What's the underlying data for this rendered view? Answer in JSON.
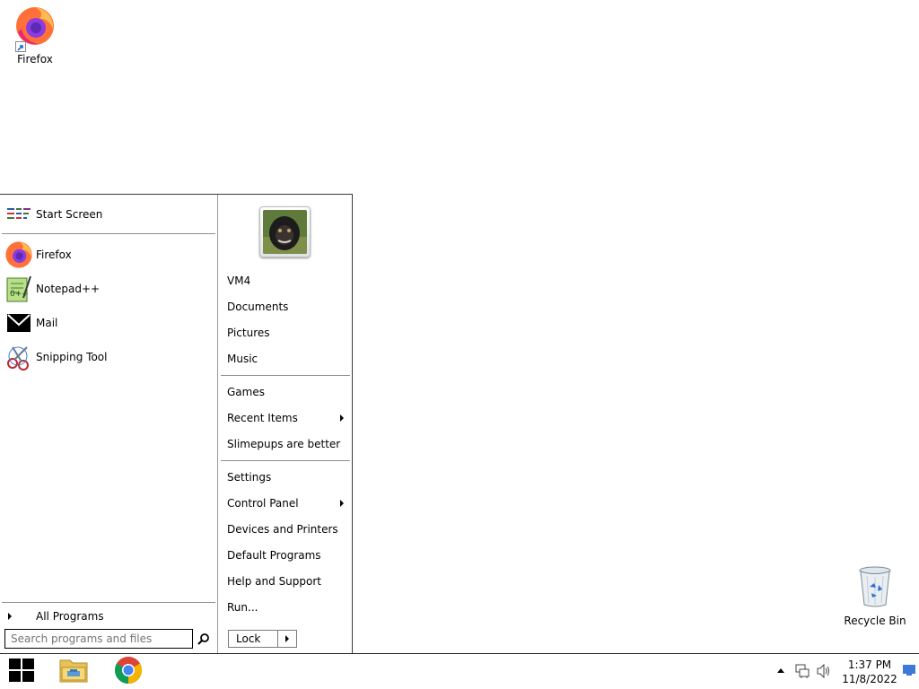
{
  "desktop": {
    "icons": [
      {
        "label": "Firefox",
        "icon": "firefox-icon"
      },
      {
        "label": "Recycle Bin",
        "icon": "recycle-bin-icon"
      }
    ]
  },
  "start_menu": {
    "start_screen_label": "Start Screen",
    "pinned": [
      {
        "label": "Firefox",
        "icon": "firefox-icon"
      },
      {
        "label": "Notepad++",
        "icon": "notepad-plus-plus-icon"
      },
      {
        "label": "Mail",
        "icon": "mail-icon"
      },
      {
        "label": "Snipping Tool",
        "icon": "scissors-icon"
      }
    ],
    "all_programs_label": "All Programs",
    "search": {
      "placeholder": "Search programs and files",
      "value": ""
    },
    "right": {
      "group1": [
        "VM4",
        "Documents",
        "Pictures",
        "Music"
      ],
      "group2": [
        {
          "label": "Games",
          "submenu": false
        },
        {
          "label": "Recent Items",
          "submenu": true
        },
        {
          "label": "Slimepups are better",
          "submenu": false
        }
      ],
      "group3": [
        {
          "label": "Settings",
          "submenu": false
        },
        {
          "label": "Control Panel",
          "submenu": true
        },
        {
          "label": "Devices and Printers",
          "submenu": false
        },
        {
          "label": "Default Programs",
          "submenu": false
        },
        {
          "label": "Help and Support",
          "submenu": false
        },
        {
          "label": "Run...",
          "submenu": false
        }
      ],
      "lock_label": "Lock"
    }
  },
  "taskbar": {
    "apps": [
      {
        "name": "File Explorer",
        "icon": "folder-icon"
      },
      {
        "name": "Google Chrome",
        "icon": "chrome-icon"
      }
    ],
    "clock": {
      "time": "1:37 PM",
      "date": "11/8/2022"
    }
  }
}
